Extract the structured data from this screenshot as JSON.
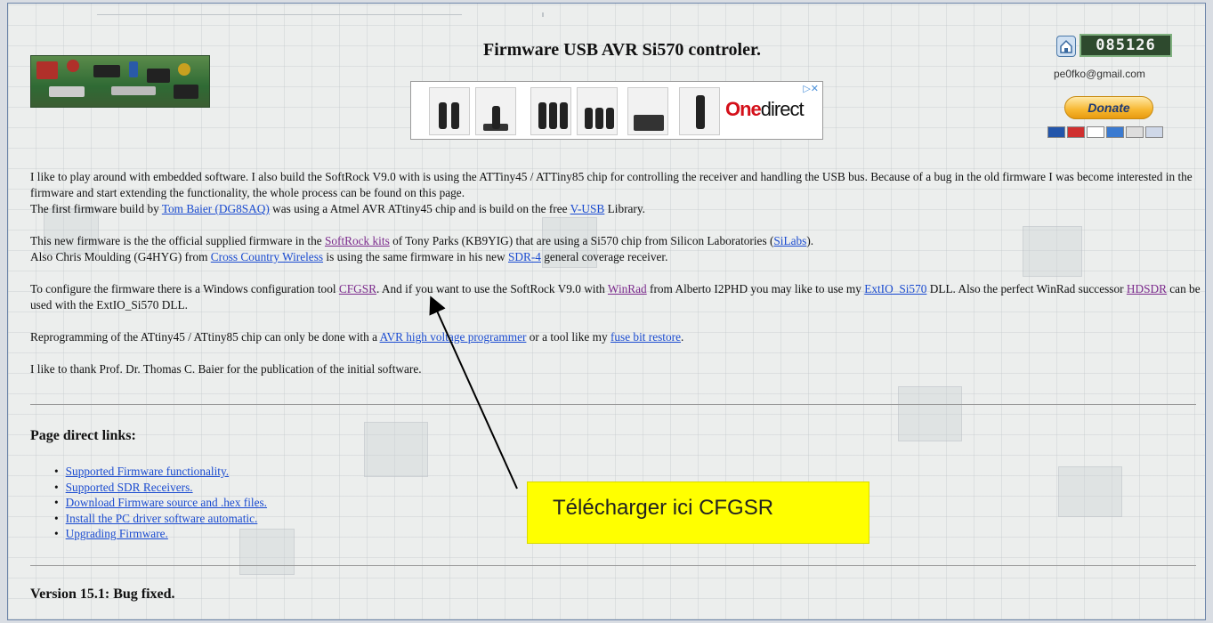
{
  "page": {
    "title": "Firmware USB AVR Si570 controler."
  },
  "header": {
    "counter": "085126",
    "email": "pe0fko@gmail.com",
    "donate_label": "Donate"
  },
  "ad": {
    "brand_prefix": "One",
    "brand_suffix": "direct",
    "info_icons": "▷✕"
  },
  "intro": {
    "p1_a": "I like to play around with embedded software. I also build the SoftRock V9.0 with is using the ATTiny45 / ATTiny85 chip for controlling the receiver and handling the USB bus. Because of a bug in the old firmware I was become interested in the firmware and start extending the functionality, the whole process can be found on this page.",
    "p1_b_pre": "The first firmware build by ",
    "link_tom": "Tom Baier (DG8SAQ)",
    "p1_b_mid": " was using a Atmel AVR ATtiny45 chip and is build on the free ",
    "link_vusb": "V-USB",
    "p1_b_post": " Library.",
    "p2_a_pre": "This new firmware is the the official supplied firmware in the ",
    "link_softrock": "SoftRock kits",
    "p2_a_mid": " of Tony Parks (KB9YIG) that are using a Si570 chip from Silicon Laboratories (",
    "link_silabs": "SiLabs",
    "p2_a_post": ").",
    "p2_b_pre": "Also Chris Moulding (G4HYG) from ",
    "link_ccw": "Cross Country Wireless",
    "p2_b_mid": " is using the same firmware in his new ",
    "link_sdr4": "SDR-4",
    "p2_b_post": " general coverage receiver.",
    "p3_pre": "To configure the firmware there is a Windows configuration tool ",
    "link_cfgsr": "CFGSR",
    "p3_mid1": ". And if you want to use the SoftRock V9.0 with ",
    "link_winrad": "WinRad",
    "p3_mid2": " from Alberto I2PHD you may like to use my ",
    "link_extio": "ExtIO_Si570",
    "p3_mid3": " DLL. Also the perfect WinRad successor ",
    "link_hdsdr": "HDSDR",
    "p3_post": " can be used with the ExtIO_Si570 DLL.",
    "p4_pre": "Reprogramming of the ATtiny45 / ATtiny85 chip can only be done with a ",
    "link_avrhv": "AVR high voltage programmer",
    "p4_mid": " or a tool like my ",
    "link_fuse": "fuse bit restore",
    "p4_post": ".",
    "p5": "I like to thank Prof. Dr. Thomas C. Baier for the publication of the initial software."
  },
  "direct_links": {
    "heading": "Page direct links:",
    "items": [
      "Supported Firmware functionality.",
      "Supported SDR Receivers.",
      "Download Firmware source and .hex files.",
      "Install the PC driver software automatic.",
      "Upgrading Firmware."
    ]
  },
  "callout": {
    "text": "Télécharger  ici CFGSR"
  },
  "version": {
    "heading": "Version 15.1: Bug fixed."
  }
}
